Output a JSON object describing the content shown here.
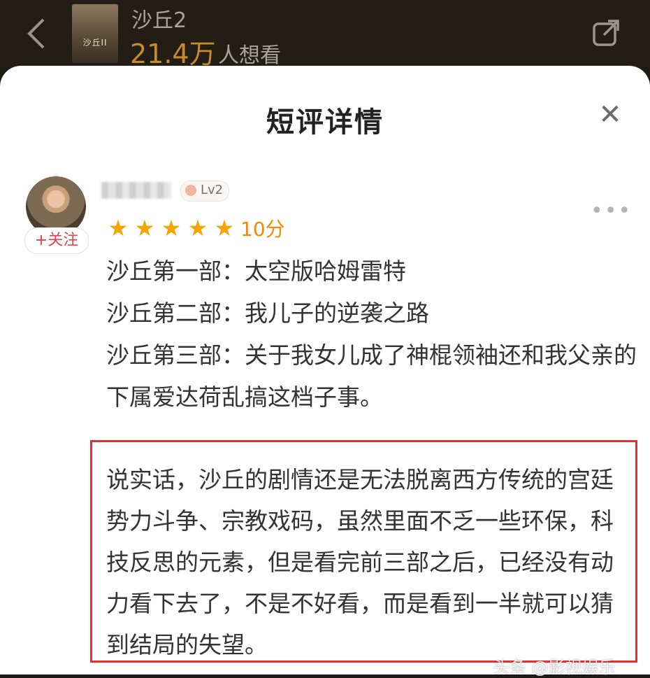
{
  "header": {
    "back_icon": "chevron-left-icon",
    "poster_title": "沙丘II",
    "movie_title": "沙丘2",
    "want_count": "21.4万",
    "want_suffix": "人想看",
    "share_icon": "share-icon"
  },
  "sheet": {
    "title": "短评详情",
    "close_icon": "close-icon",
    "close_glyph": "✕"
  },
  "review": {
    "follow_label": "+关注",
    "level": "Lv2",
    "more_glyph": "•••",
    "stars": 5,
    "score": "10分",
    "lines": [
      "沙丘第一部：太空版哈姆雷特",
      "沙丘第二部：我儿子的逆袭之路",
      "沙丘第三部：关于我女儿成了神棍领袖还和我父亲的下属爱达荷乱搞这档子事。"
    ],
    "highlight_text": "说实话，沙丘的剧情还是无法脱离西方传统的宫廷势力斗争、宗教戏码，虽然里面不乏一些环保，科技反思的元素，但是看完前三部之后，已经没有动力看下去了，不是不好看，而是看到一半就可以猜到结局的失望。"
  },
  "watermark": "头条 @影视娱乐",
  "colors": {
    "star": "#f7a400",
    "score": "#f08a00",
    "highlight_border": "#e03030",
    "follow": "#e0434b",
    "want_count": "#c98a2b"
  }
}
